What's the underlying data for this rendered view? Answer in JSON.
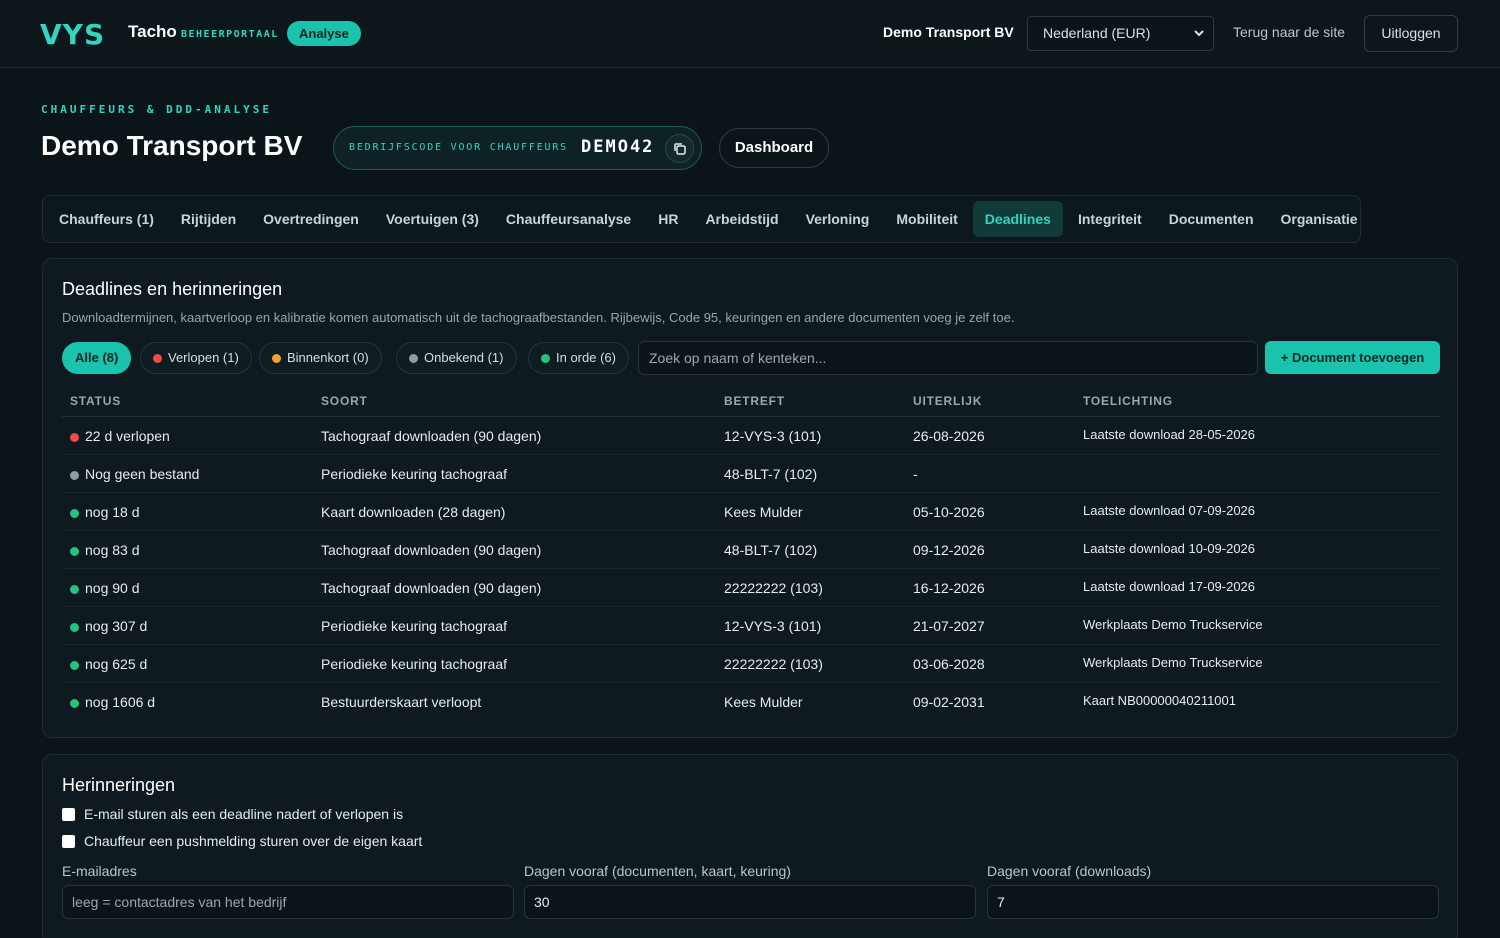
{
  "header": {
    "logo_text": "VYS",
    "brand": "Tacho",
    "brand_sub": "BEHEERPORTAAL",
    "badge": "Analyse",
    "company": "Demo Transport BV",
    "country": "Nederland (EUR)",
    "back_link": "Terug naar de site",
    "logout": "Uitloggen"
  },
  "page": {
    "eyebrow": "CHAUFFEURS & DDD-ANALYSE",
    "title": "Demo Transport BV",
    "code_label": "BEDRIJFSCODE VOOR CHAUFFEURS",
    "code_value": "DEMO42",
    "dashboard_button": "Dashboard"
  },
  "tabs": [
    {
      "label": "Chauffeurs (1)"
    },
    {
      "label": "Rijtijden"
    },
    {
      "label": "Overtredingen"
    },
    {
      "label": "Voertuigen (3)"
    },
    {
      "label": "Chauffeursanalyse"
    },
    {
      "label": "HR"
    },
    {
      "label": "Arbeidstijd"
    },
    {
      "label": "Verloning"
    },
    {
      "label": "Mobiliteit"
    },
    {
      "label": "Deadlines",
      "active": true
    },
    {
      "label": "Integriteit"
    },
    {
      "label": "Documenten"
    },
    {
      "label": "Organisatie"
    }
  ],
  "deadlines": {
    "title": "Deadlines en herinneringen",
    "description": "Downloadtermijnen, kaartverloop en kalibratie komen automatisch uit de tachograafbestanden. Rijbewijs, Code 95, keuringen en andere documenten voeg je zelf toe.",
    "filters": [
      {
        "label": "Alle (8)",
        "active": true
      },
      {
        "label": "Verlopen (1)",
        "color": "#f04a4a"
      },
      {
        "label": "Binnenkort (0)",
        "color": "#f4a32a"
      },
      {
        "label": "Onbekend (1)",
        "color": "#8f9ca1"
      },
      {
        "label": "In orde (6)",
        "color": "#22c57a"
      }
    ],
    "search_placeholder": "Zoek op naam of kenteken...",
    "add_button": "+ Document toevoegen",
    "columns": [
      "STATUS",
      "SOORT",
      "BETREFT",
      "UITERLIJK",
      "TOELICHTING"
    ],
    "rows": [
      {
        "status": "22 d verlopen",
        "color": "#f04a4a",
        "type": "Tachograaf downloaden (90 dagen)",
        "subject": "12-VYS-3 (101)",
        "due": "26-08-2026",
        "note": "Laatste download 28-05-2026"
      },
      {
        "status": "Nog geen bestand",
        "color": "#8f9ca1",
        "type": "Periodieke keuring tachograaf",
        "subject": "48-BLT-7 (102)",
        "due": "-",
        "note": ""
      },
      {
        "status": "nog 18 d",
        "color": "#22c57a",
        "type": "Kaart downloaden (28 dagen)",
        "subject": "Kees Mulder",
        "due": "05-10-2026",
        "note": "Laatste download 07-09-2026"
      },
      {
        "status": "nog 83 d",
        "color": "#22c57a",
        "type": "Tachograaf downloaden (90 dagen)",
        "subject": "48-BLT-7 (102)",
        "due": "09-12-2026",
        "note": "Laatste download 10-09-2026"
      },
      {
        "status": "nog 90 d",
        "color": "#22c57a",
        "type": "Tachograaf downloaden (90 dagen)",
        "subject": "22222222 (103)",
        "due": "16-12-2026",
        "note": "Laatste download 17-09-2026"
      },
      {
        "status": "nog 307 d",
        "color": "#22c57a",
        "type": "Periodieke keuring tachograaf",
        "subject": "12-VYS-3 (101)",
        "due": "21-07-2027",
        "note": "Werkplaats Demo Truckservice"
      },
      {
        "status": "nog 625 d",
        "color": "#22c57a",
        "type": "Periodieke keuring tachograaf",
        "subject": "22222222 (103)",
        "due": "03-06-2028",
        "note": "Werkplaats Demo Truckservice"
      },
      {
        "status": "nog 1606 d",
        "color": "#22c57a",
        "type": "Bestuurderskaart verloopt",
        "subject": "Kees Mulder",
        "due": "09-02-2031",
        "note": "Kaart NB00000040211001"
      }
    ]
  },
  "reminders": {
    "title": "Herinneringen",
    "email_check": "E-mail sturen als een deadline nadert of verlopen is",
    "push_check": "Chauffeur een pushmelding sturen over de eigen kaart",
    "email_label": "E-mailadres",
    "email_placeholder": "leeg = contactadres van het bedrijf",
    "days_docs_label": "Dagen vooraf (documenten, kaart, keuring)",
    "days_docs_value": "30",
    "days_dl_label": "Dagen vooraf (downloads)",
    "days_dl_value": "7"
  }
}
